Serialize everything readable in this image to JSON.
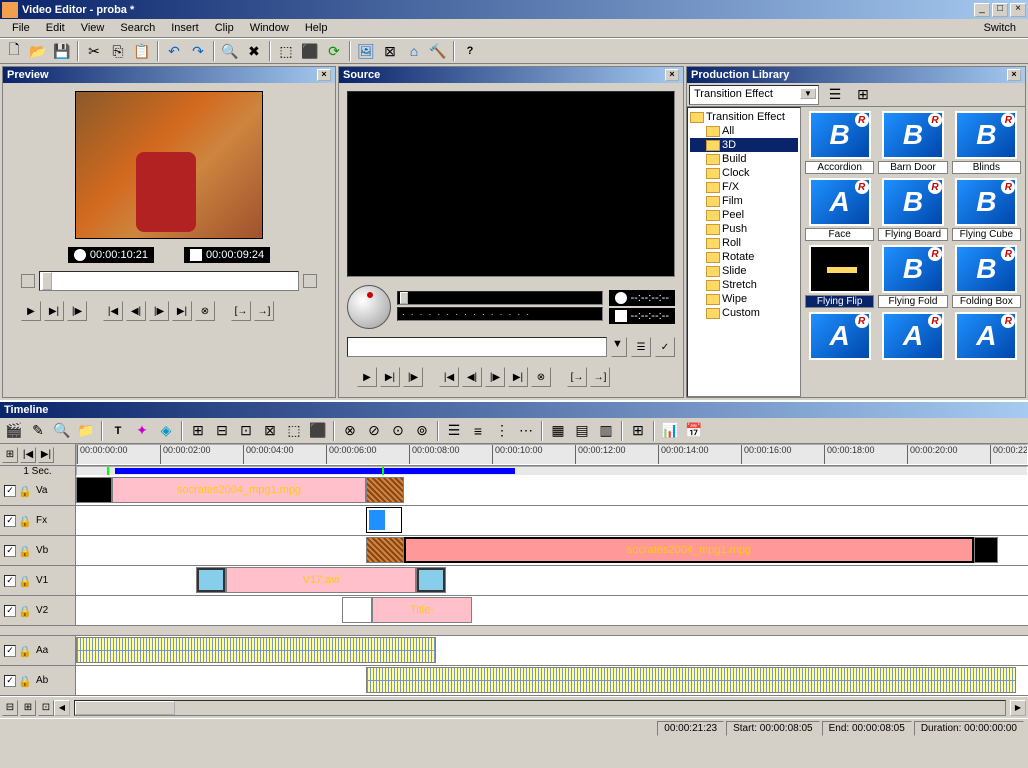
{
  "window": {
    "title": "Video Editor - proba *"
  },
  "menus": [
    "File",
    "Edit",
    "View",
    "Search",
    "Insert",
    "Clip",
    "Window",
    "Help"
  ],
  "switch_label": "Switch",
  "panes": {
    "preview": {
      "title": "Preview",
      "tc1": "00:00:10:21",
      "tc2": "00:00:09:24"
    },
    "source": {
      "title": "Source",
      "tc1": "--:--:--:--",
      "tc2": "--:--:--:--"
    },
    "library": {
      "title": "Production Library",
      "dropdown": "Transition Effect",
      "tree_root": "Transition Effect",
      "tree": [
        "All",
        "3D",
        "Build",
        "Clock",
        "F/X",
        "Film",
        "Peel",
        "Push",
        "Roll",
        "Rotate",
        "Slide",
        "Stretch",
        "Wipe",
        "Custom"
      ],
      "tree_selected": "3D",
      "items": [
        {
          "label": "Accordion",
          "letter": "B"
        },
        {
          "label": "Barn Door",
          "letter": "B"
        },
        {
          "label": "Blinds",
          "letter": "B"
        },
        {
          "label": "Face",
          "letter": "A"
        },
        {
          "label": "Flying Board",
          "letter": "B"
        },
        {
          "label": "Flying Cube",
          "letter": "B"
        },
        {
          "label": "Flying Flip",
          "letter": "",
          "selected": true
        },
        {
          "label": "Flying Fold",
          "letter": "B"
        },
        {
          "label": "Folding Box",
          "letter": "B"
        },
        {
          "label": "",
          "letter": "A"
        },
        {
          "label": "",
          "letter": "A"
        },
        {
          "label": "",
          "letter": "A"
        }
      ]
    }
  },
  "timeline": {
    "title": "Timeline",
    "unit": "1 Sec.",
    "ruler": [
      "00:00:00:00",
      "00:00:02:00",
      "00:00:04:00",
      "00:00:06:00",
      "00:00:08:00",
      "00:00:10:00",
      "00:00:12:00",
      "00:00:14:00",
      "00:00:16:00",
      "00:00:18:00",
      "00:00:20:00",
      "00:00:22:0"
    ],
    "tracks": [
      "Va",
      "Fx",
      "Vb",
      "V1",
      "V2"
    ],
    "audio_tracks": [
      "Aa",
      "Ab"
    ],
    "clips": {
      "va_label": "socrates2004_mpg1.mpg",
      "vb_label": "socrates2004_mpg1.mpg",
      "v1_label": "V17.avi",
      "v2_label": "Title-"
    }
  },
  "status": {
    "pos": "00:00:21:23",
    "start": "Start: 00:00:08:05",
    "end": "End: 00:00:08:05",
    "duration": "Duration: 00:00:00:00"
  }
}
